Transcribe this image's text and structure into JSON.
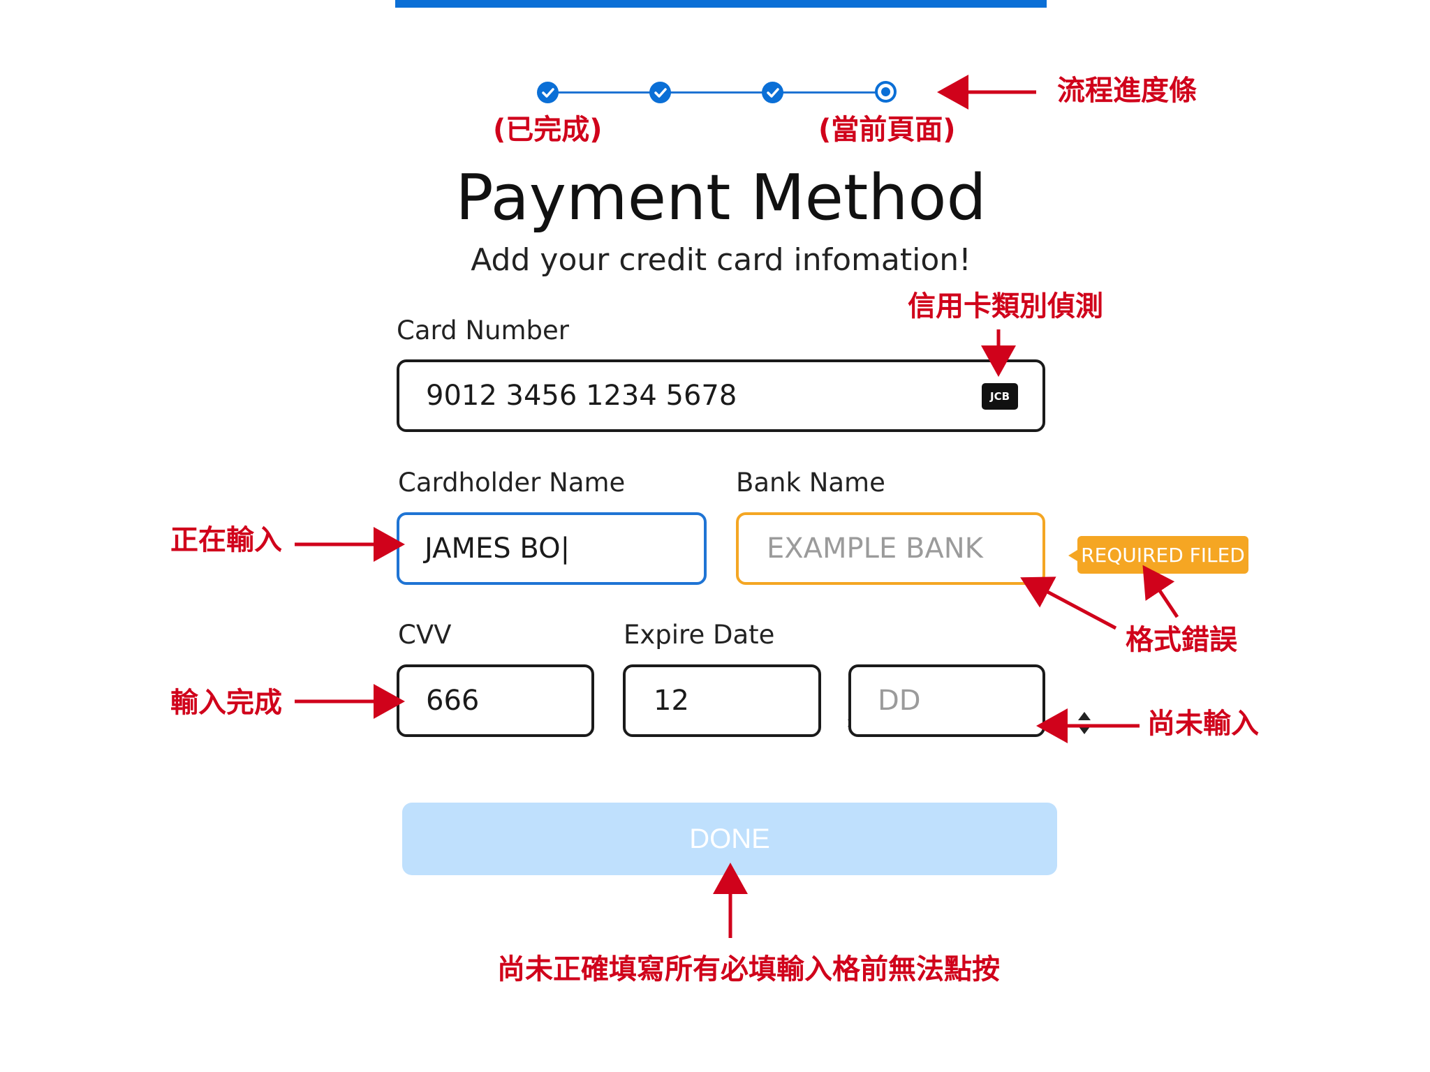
{
  "stepper": {
    "steps": [
      {
        "status": "completed"
      },
      {
        "status": "completed"
      },
      {
        "status": "completed"
      },
      {
        "status": "current"
      }
    ],
    "accent_color": "#0b6fd6"
  },
  "header": {
    "title": "Payment Method",
    "subtitle": "Add your credit card infomation!"
  },
  "form": {
    "card_number": {
      "label": "Card Number",
      "value": "9012 3456 1234 5678",
      "card_type": "JCB"
    },
    "cardholder_name": {
      "label": "Cardholder Name",
      "value": "JAMES BO|"
    },
    "bank_name": {
      "label": "Bank Name",
      "placeholder": "EXAMPLE BANK",
      "error_badge": "REQUIRED FILED"
    },
    "cvv": {
      "label": "CVV",
      "value": "666"
    },
    "expire_date": {
      "label": "Expire Date",
      "month_value": "12",
      "day_placeholder": "DD"
    },
    "done_button": "DONE"
  },
  "annotations": {
    "progress_bar": "流程進度條",
    "completed": "(已完成)",
    "current_page": "(當前頁面)",
    "card_type_detection": "信用卡類別偵測",
    "typing": "正在輸入",
    "format_error": "格式錯誤",
    "input_completed": "輸入完成",
    "not_yet_input": "尚未輸入",
    "button_disabled_note": "尚未正確填寫所有必填輸入格前無法點按",
    "color": "#d0021b"
  },
  "colors": {
    "primary": "#0b6fd6",
    "focus": "#1f74d4",
    "warning": "#f5a623",
    "disabled_button": "#bfe0fd"
  }
}
